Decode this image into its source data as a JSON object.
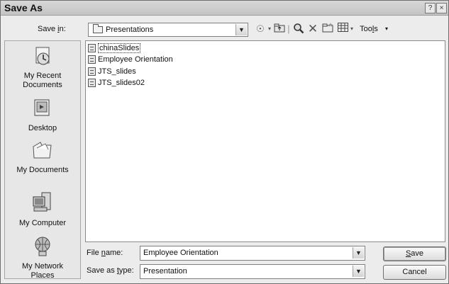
{
  "window": {
    "title": "Save As",
    "help_btn": "?",
    "close_btn": "×"
  },
  "save_in": {
    "label_pre": "Save ",
    "label_key": "i",
    "label_post": "n:",
    "value": "Presentations"
  },
  "toolbar": {
    "tools_pre": "Too",
    "tools_key": "l",
    "tools_post": "s"
  },
  "places": [
    {
      "label1": "My Recent",
      "label2": "Documents"
    },
    {
      "label1": "Desktop",
      "label2": ""
    },
    {
      "label1": "My Documents",
      "label2": ""
    },
    {
      "label1": "My Computer",
      "label2": ""
    },
    {
      "label1": "My Network",
      "label2": "Places"
    }
  ],
  "files": [
    "chinaSlides",
    "Employee Orientation",
    "JTS_slides",
    "JTS_slides02"
  ],
  "file_name": {
    "label_pre": "File ",
    "label_key": "n",
    "label_post": "ame:",
    "value": "Employee Orientation"
  },
  "save_type": {
    "label_pre": "Save as ",
    "label_key": "t",
    "label_post": "ype:",
    "value": "Presentation"
  },
  "buttons": {
    "save_key": "S",
    "save_rest": "ave",
    "cancel": "Cancel"
  }
}
